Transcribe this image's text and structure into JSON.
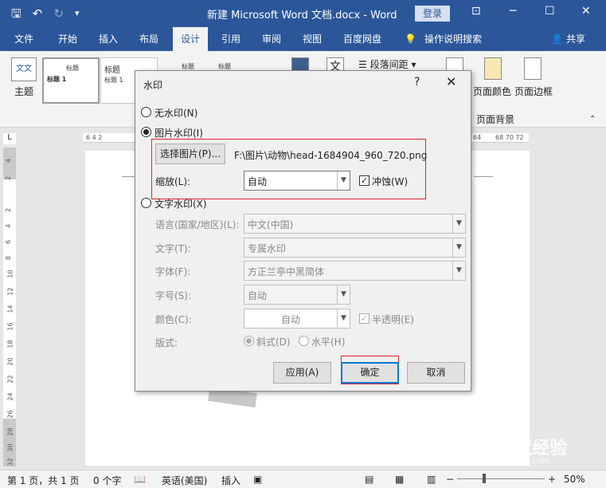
{
  "titlebar": {
    "doc_title": "新建 Microsoft Word 文档.docx  -  Word",
    "login": "登录",
    "qat_icons": [
      "save-icon",
      "undo-icon",
      "redo-icon",
      "customize-icon"
    ],
    "window_controls": [
      "ribbon-display-icon",
      "minimize-icon",
      "maximize-icon",
      "close-icon"
    ]
  },
  "tabs": [
    "文件",
    "开始",
    "插入",
    "布局",
    "设计",
    "引用",
    "审阅",
    "视图",
    "百度网盘"
  ],
  "active_tab": "设计",
  "tell_me": "操作说明搜索",
  "share": "共享",
  "ribbon": {
    "theme": "主题",
    "theme_icon_text": "文文",
    "style_thumbs": [
      {
        "title": "标题",
        "heading": "标题 1"
      },
      {
        "title": "标题",
        "heading": "标题 1"
      },
      {
        "title": "标题",
        "heading": ""
      },
      {
        "title": "标题",
        "heading": ""
      }
    ],
    "para_spacing": "段落间距",
    "page_color": "页面颜色",
    "page_border": "页面边框",
    "page_bg_group": "页面背景"
  },
  "ruler": {
    "left_marks": "6  4  2",
    "right_marks": "68 70 72",
    "right_mark_64": "64",
    "v_marks": [
      "4",
      "2",
      "2",
      "4",
      "6",
      "8",
      "10",
      "12",
      "14",
      "16",
      "18",
      "20",
      "22",
      "24",
      "26",
      "28",
      "30",
      "32"
    ]
  },
  "dialog": {
    "title": "水印",
    "help": "?",
    "close": "✕",
    "no_watermark": "无水印(N)",
    "picture_watermark": "图片水印(I)",
    "select_picture": "选择图片(P)...",
    "picture_path": "F:\\图片\\动物\\head-1684904_960_720.png",
    "scale_label": "缩放(L):",
    "scale_value": "自动",
    "washout": "冲蚀(W)",
    "text_watermark": "文字水印(X)",
    "language_label": "语言(国家/地区)(L):",
    "language_value": "中文(中国)",
    "text_label": "文字(T):",
    "text_value": "专属水印",
    "font_label": "字体(F):",
    "font_value": "方正兰亭中黑简体",
    "size_label": "字号(S):",
    "size_value": "自动",
    "color_label": "颜色(C):",
    "color_value": "自动",
    "semitransparent": "半透明(E)",
    "layout_label": "版式:",
    "diagonal": "斜式(D)",
    "horizontal": "水平(H)",
    "apply": "应用(A)",
    "ok": "确定",
    "cancel": "取消"
  },
  "statusbar": {
    "page": "第 1 页，共 1 页",
    "words": "0 个字",
    "language": "英语(美国)",
    "mode": "插入",
    "zoom": "50%",
    "zoom_minus": "−",
    "zoom_plus": "+"
  },
  "baidu_watermark": {
    "logo": "Bai百度经验",
    "url": "jingyan.baidu.com"
  },
  "colors": {
    "brand": "#2b579a",
    "highlight": "#e0232f",
    "default_button_border": "#0078d7"
  }
}
